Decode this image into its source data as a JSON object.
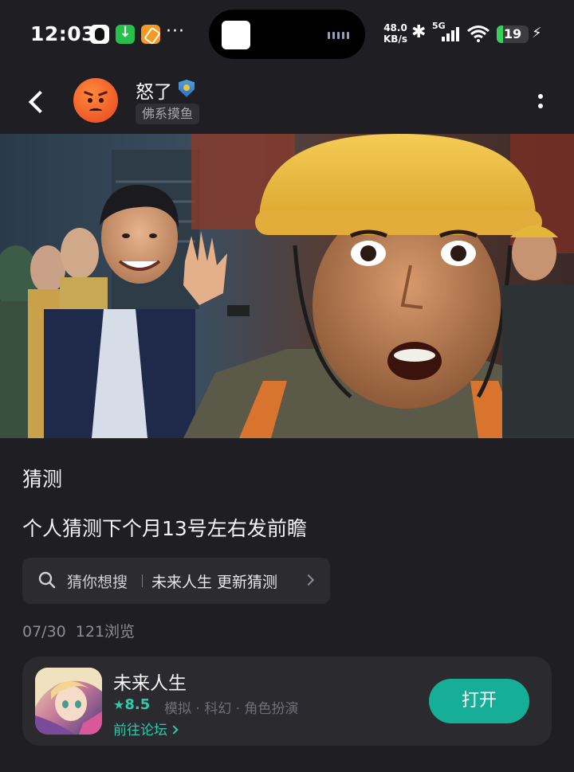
{
  "status_bar": {
    "time": "12:03",
    "more": "···",
    "net_speed_value": "48.0",
    "net_speed_unit": "KB/s",
    "network": "5G",
    "battery": "19",
    "battery_level": 0.19,
    "icons": [
      "qq-icon",
      "download-icon",
      "orange-app-icon",
      "bluetooth-icon",
      "signal-icon",
      "wifi-icon",
      "battery-icon",
      "charging-icon"
    ]
  },
  "header": {
    "username": "怒了",
    "group_tag": "佛系摸鱼",
    "icons": [
      "back-icon",
      "angry-face-avatar",
      "shield-badge-icon",
      "more-vertical-icon"
    ]
  },
  "post": {
    "title": "猜测",
    "body": "个人猜测下个月13号左右发前瞻",
    "search_chip": {
      "label": "猜你想搜",
      "query": "未来人生 更新猜测"
    },
    "date": "07/30",
    "views": "121浏览"
  },
  "app_card": {
    "name": "未来人生",
    "rating_star": "★",
    "rating": "8.5",
    "tags": "模拟 · 科幻 · 角色扮演",
    "forum_link": "前往论坛",
    "open_button": "打开"
  },
  "colors": {
    "background": "#1f1f23",
    "card": "#2a2a2f",
    "accent": "#16ae96",
    "accent_text": "#2ec9a8"
  }
}
